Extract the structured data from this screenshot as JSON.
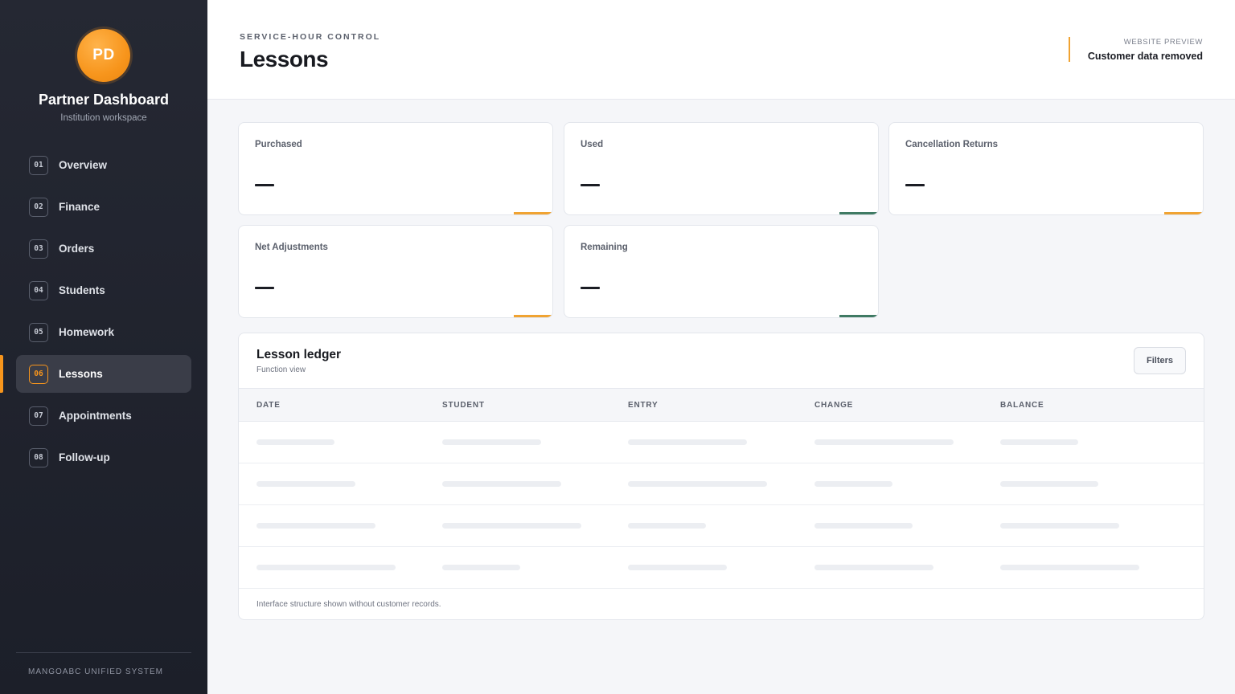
{
  "sidebar": {
    "avatar_initials": "PD",
    "brand_title": "Partner Dashboard",
    "brand_subtitle": "Institution workspace",
    "items": [
      {
        "num": "01",
        "label": "Overview",
        "active": false
      },
      {
        "num": "02",
        "label": "Finance",
        "active": false
      },
      {
        "num": "03",
        "label": "Orders",
        "active": false
      },
      {
        "num": "04",
        "label": "Students",
        "active": false
      },
      {
        "num": "05",
        "label": "Homework",
        "active": false
      },
      {
        "num": "06",
        "label": "Lessons",
        "active": true
      },
      {
        "num": "07",
        "label": "Appointments",
        "active": false
      },
      {
        "num": "08",
        "label": "Follow-up",
        "active": false
      }
    ],
    "footer": "MANGOABC UNIFIED SYSTEM"
  },
  "header": {
    "eyebrow": "SERVICE-HOUR CONTROL",
    "title": "Lessons",
    "preview_label": "WEBSITE PREVIEW",
    "preview_value": "Customer data removed"
  },
  "cards": [
    {
      "label": "Purchased",
      "accent": "#f0a332"
    },
    {
      "label": "Used",
      "accent": "#3f7a63"
    },
    {
      "label": "Cancellation Returns",
      "accent": "#f0a332"
    },
    {
      "label": "Net Adjustments",
      "accent": "#f0a332"
    },
    {
      "label": "Remaining",
      "accent": "#3f7a63"
    }
  ],
  "ledger": {
    "title": "Lesson ledger",
    "subtitle": "Function view",
    "filters_label": "Filters",
    "columns": [
      "DATE",
      "STUDENT",
      "ENTRY",
      "CHANGE",
      "BALANCE"
    ],
    "note": "Interface structure shown without customer records."
  },
  "colors": {
    "accent": "#f7951c",
    "accent_soft": "#f0a332",
    "green": "#3f7a63",
    "sidebar_bg": "#252833"
  }
}
